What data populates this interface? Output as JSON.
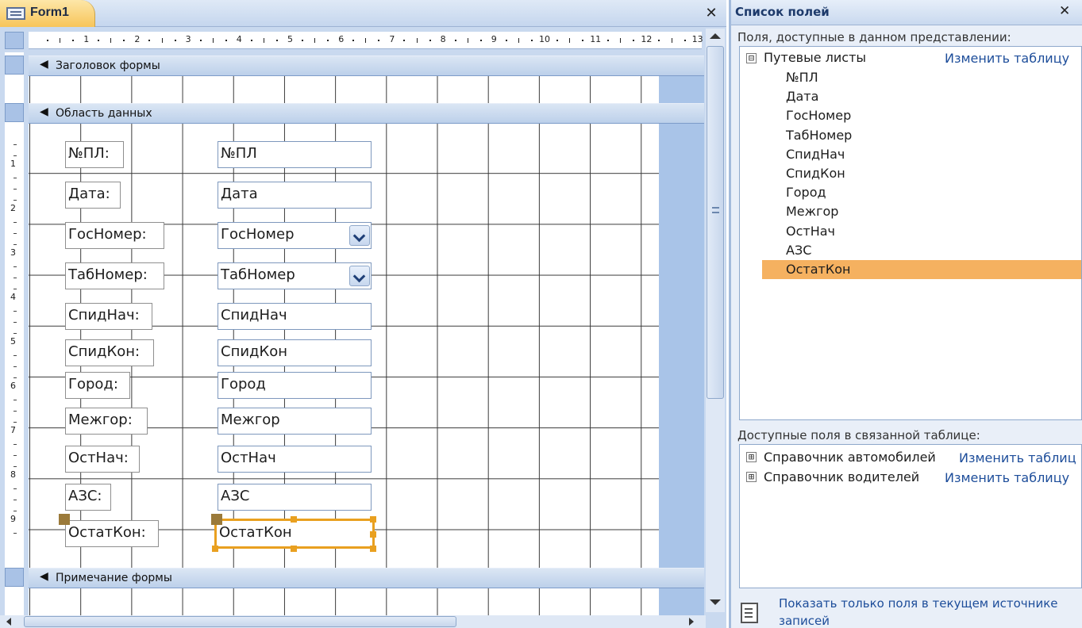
{
  "form_window": {
    "tab_label": "Form1",
    "ruler_numbers": [
      "1",
      "2",
      "3",
      "4",
      "5",
      "6",
      "7",
      "8",
      "9",
      "10",
      "11",
      "12",
      "13"
    ],
    "vruler_numbers": [
      "1",
      "2",
      "3",
      "4",
      "5",
      "6",
      "7",
      "8",
      "9"
    ]
  },
  "sections": {
    "header": "Заголовок формы",
    "detail": "Область данных",
    "footer": "Примечание формы"
  },
  "controls": [
    {
      "label": "№ПЛ:",
      "field": "№ПЛ",
      "type": "textbox"
    },
    {
      "label": "Дата:",
      "field": "Дата",
      "type": "textbox"
    },
    {
      "label": "ГосНомер:",
      "field": "ГосНомер",
      "type": "combobox"
    },
    {
      "label": "ТабНомер:",
      "field": "ТабНомер",
      "type": "combobox"
    },
    {
      "label": "СпидНач:",
      "field": "СпидНач",
      "type": "textbox"
    },
    {
      "label": "СпидКон:",
      "field": "СпидКон",
      "type": "textbox"
    },
    {
      "label": "Город:",
      "field": "Город",
      "type": "textbox"
    },
    {
      "label": "Межгор:",
      "field": "Межгор",
      "type": "textbox"
    },
    {
      "label": "ОстНач:",
      "field": "ОстНач",
      "type": "textbox"
    },
    {
      "label": "АЗС:",
      "field": "АЗС",
      "type": "textbox"
    },
    {
      "label": "ОстатКон:",
      "field": "ОстатКон",
      "type": "textbox",
      "selected": true
    }
  ],
  "field_list": {
    "title": "Список полей",
    "available_heading": "Поля, доступные в данном представлении:",
    "table": {
      "name": "Путевые листы",
      "toggle": "⊟",
      "edit_link": "Изменить таблицу"
    },
    "fields": [
      "№ПЛ",
      "Дата",
      "ГосНомер",
      "ТабНомер",
      "СпидНач",
      "СпидКон",
      "Город",
      "Межгор",
      "ОстНач",
      "АЗС",
      "ОстатКон"
    ],
    "highlighted_field": "ОстатКон",
    "related_heading": "Доступные поля в связанной таблице:",
    "related_tables": [
      {
        "name": "Справочник автомобилей",
        "toggle": "⊞",
        "edit_link": "Изменить таблиц"
      },
      {
        "name": "Справочник водителей",
        "toggle": "⊞",
        "edit_link": "Изменить таблицу"
      }
    ],
    "show_only_text": "Показать только поля в текущем источнике записей"
  },
  "icons": {
    "form": "form-icon",
    "close": "close-icon",
    "section_arrow": "section-arrow-icon",
    "combo_arrow": "chevron-down-icon",
    "tree_toggle": "tree-toggle-icon",
    "show_only": "field-list-icon"
  },
  "colors": {
    "selection": "#e9a020",
    "highlight_row": "#f5b160",
    "tab": "#f7c55a",
    "pane_title": "#1d3a6b"
  }
}
